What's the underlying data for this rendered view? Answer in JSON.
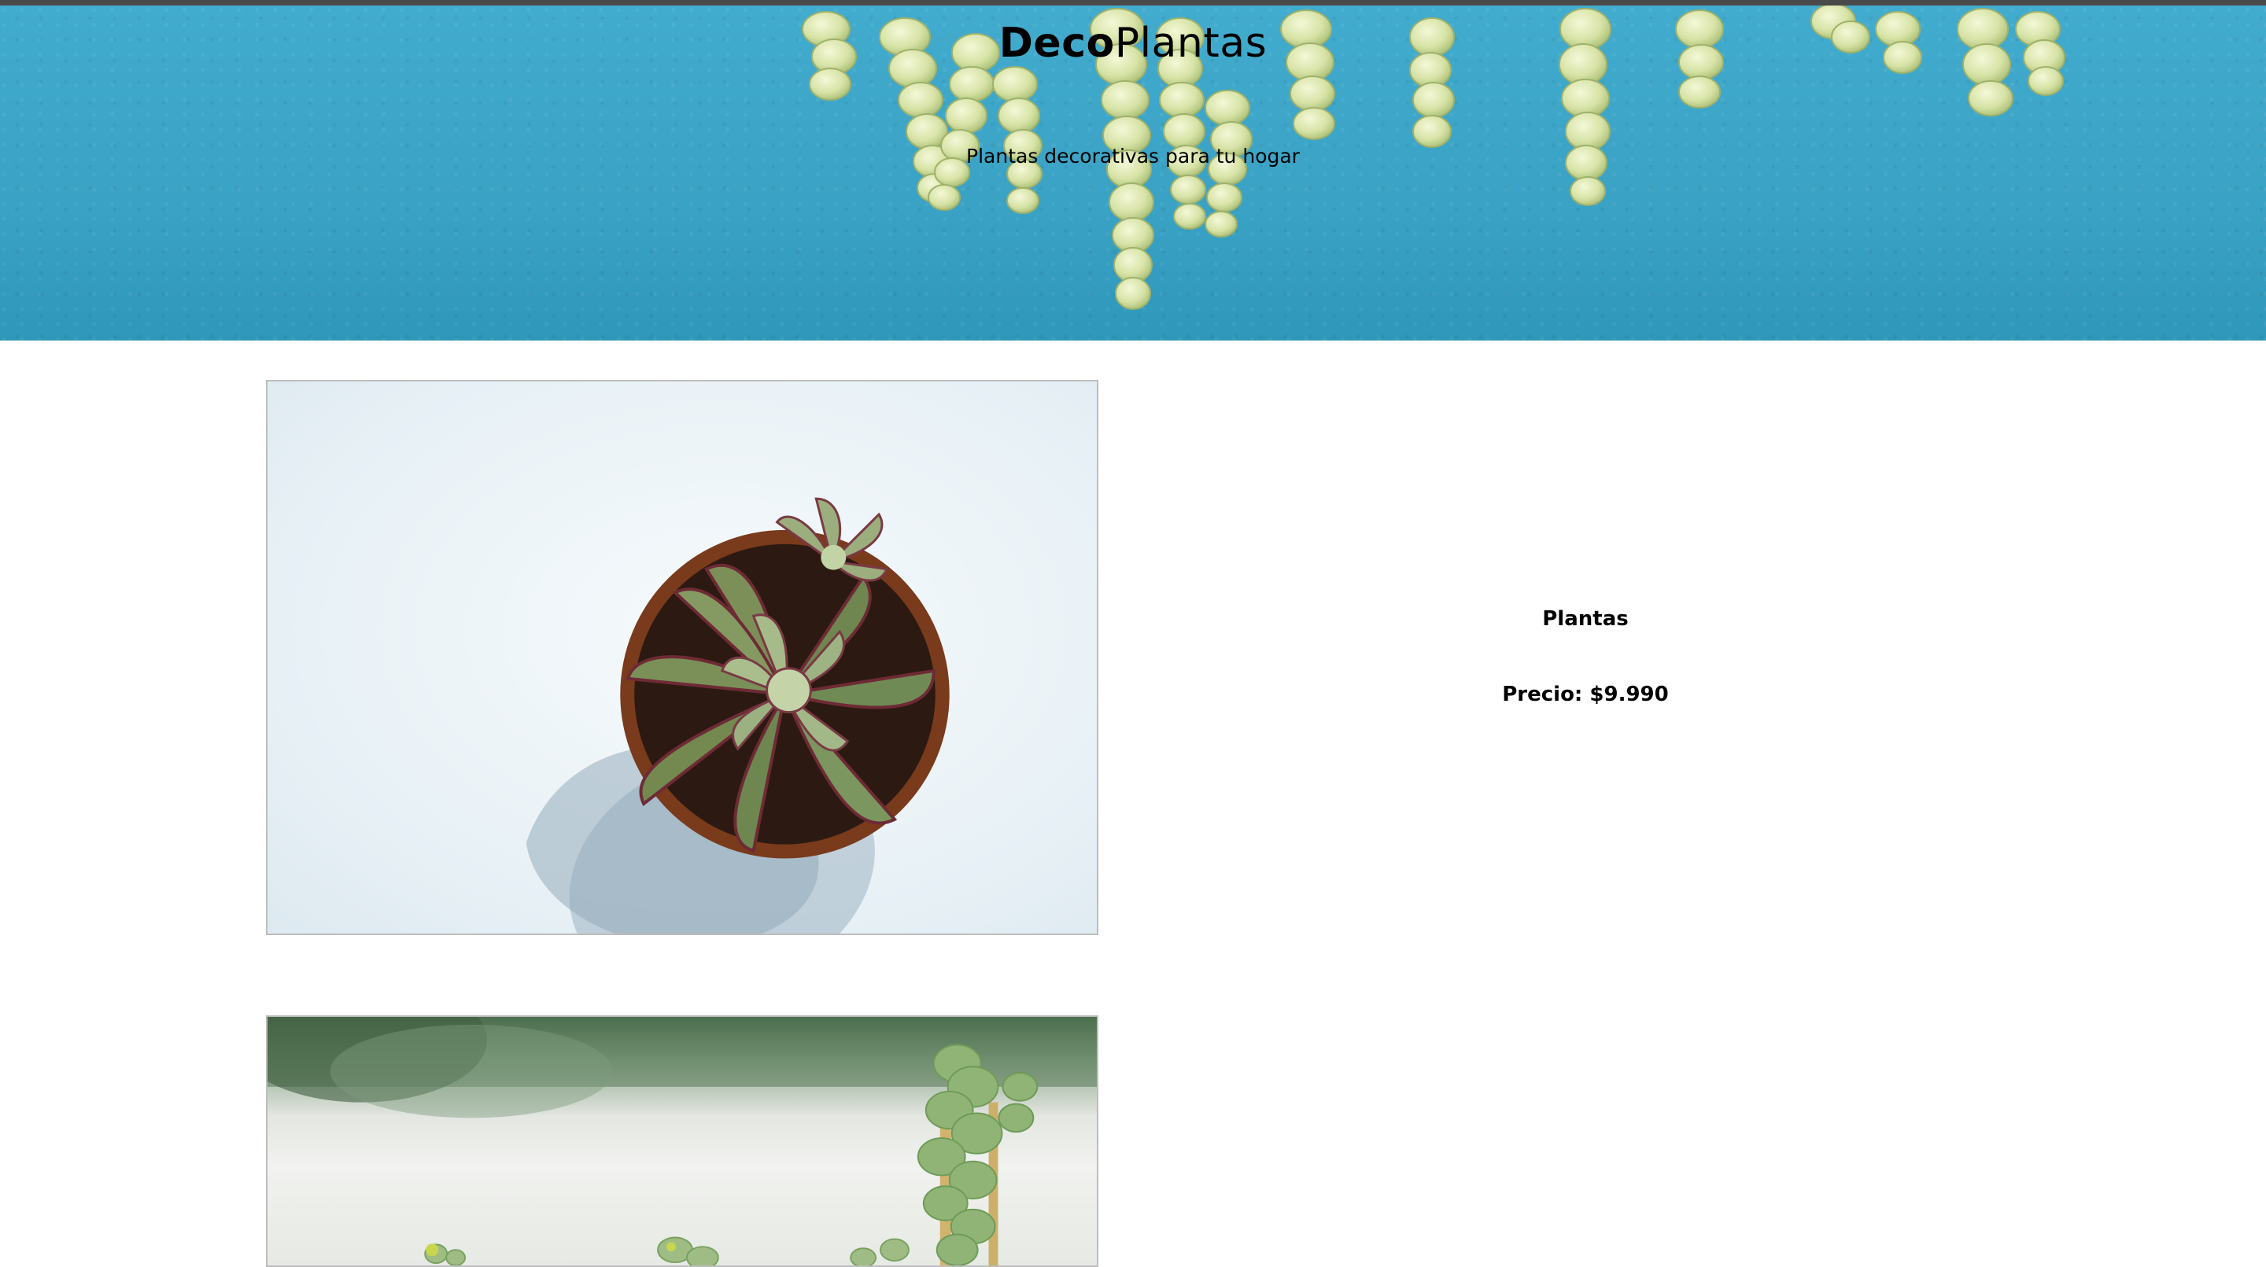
{
  "header": {
    "brand_bold": "Deco",
    "brand_regular": "Plantas",
    "tagline": "Plantas decorativas para tu hogar"
  },
  "products": [
    {
      "name": "Plantas",
      "price_label": "Precio:",
      "price_value": "$9.990",
      "image": "succulent-in-pot-photo"
    },
    {
      "name": "",
      "image": "hanging-succulents-photo"
    }
  ],
  "colors": {
    "hero_bg": "#3ea7c9",
    "topbar": "#4a4a4a",
    "image_border": "#bdbdbd"
  }
}
